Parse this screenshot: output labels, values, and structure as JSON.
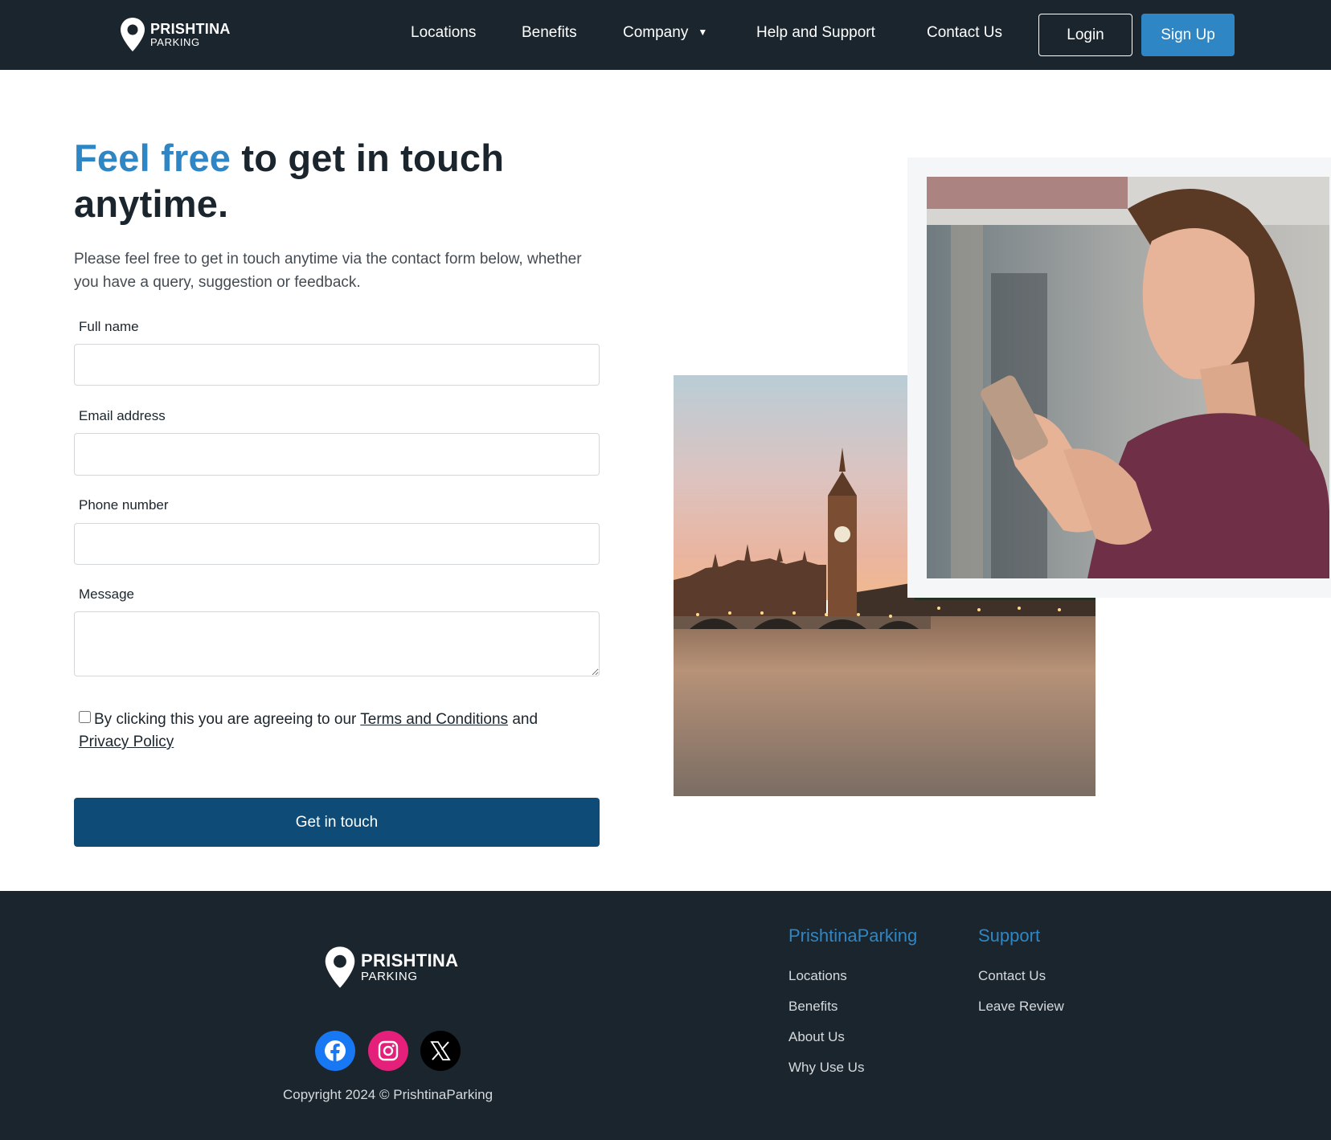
{
  "brand": {
    "name": "PRISHTINA",
    "sub": "PARKING"
  },
  "nav": {
    "items": [
      "Locations",
      "Benefits",
      "Company",
      "Help and Support",
      "Contact Us"
    ],
    "login": "Login",
    "signup": "Sign Up"
  },
  "hero": {
    "headline_accent": "Feel free",
    "headline_rest": " to get in touch anytime.",
    "lead": "Please feel free to get in touch anytime via the contact form below, whether you have a query, suggestion or feedback."
  },
  "form": {
    "fields": [
      {
        "label": "Full name",
        "value": "",
        "placeholder": ""
      },
      {
        "label": "Email address",
        "value": "",
        "placeholder": ""
      },
      {
        "label": "Phone number",
        "value": "",
        "placeholder": ""
      },
      {
        "label": "Message",
        "value": "",
        "placeholder": ""
      }
    ],
    "consent_prefix": "By clicking this you are agreeing to our ",
    "terms_link": "Terms and Conditions",
    "consent_and": " and ",
    "privacy_link": "Privacy Policy",
    "consent_checked": false,
    "submit": "Get in touch"
  },
  "footer": {
    "social": [
      {
        "icon": "facebook-icon",
        "color": "#1877f2"
      },
      {
        "icon": "instagram-icon",
        "color": "#e4207a"
      },
      {
        "icon": "x-icon",
        "color": "#000000"
      }
    ],
    "copyright": "Copyright 2024 © PrishtinaParking",
    "columns": [
      {
        "title": "PrishtinaParking",
        "links": [
          "Locations",
          "Benefits",
          "About Us",
          "Why Use Us"
        ]
      },
      {
        "title": "Support",
        "links": [
          "Contact Us",
          "Leave Review"
        ]
      }
    ]
  },
  "colors": {
    "dark": "#1b252d",
    "accent": "#2f86c4",
    "submit": "#0e4c77"
  }
}
